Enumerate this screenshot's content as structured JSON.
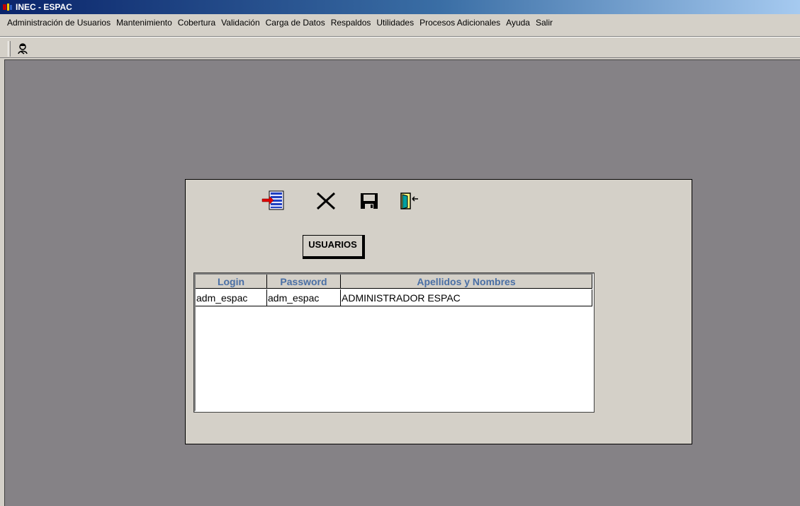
{
  "window": {
    "title": "INEC - ESPAC"
  },
  "menu": {
    "items": [
      "Administración de Usuarios",
      "Mantenimiento",
      "Cobertura",
      "Validación",
      "Carga de Datos",
      "Respaldos",
      "Utilidades",
      "Procesos Adicionales",
      "Ayuda",
      "Salir"
    ]
  },
  "toolbar": {
    "icon": "user-admin-icon"
  },
  "form": {
    "buttons": [
      {
        "icon": "add-record-icon"
      },
      {
        "icon": "delete-x-icon"
      },
      {
        "icon": "save-floppy-icon"
      },
      {
        "icon": "exit-door-icon"
      }
    ],
    "label": "USUARIOS",
    "grid": {
      "columns": [
        "Login",
        "Password",
        "Apellidos y Nombres"
      ],
      "rows": [
        [
          "adm_espac",
          "adm_espac",
          "ADMINISTRADOR ESPAC"
        ]
      ]
    }
  },
  "colors": {
    "header_text": "#4a6fa5",
    "workspace": "#858286",
    "face": "#d4d0c8"
  }
}
